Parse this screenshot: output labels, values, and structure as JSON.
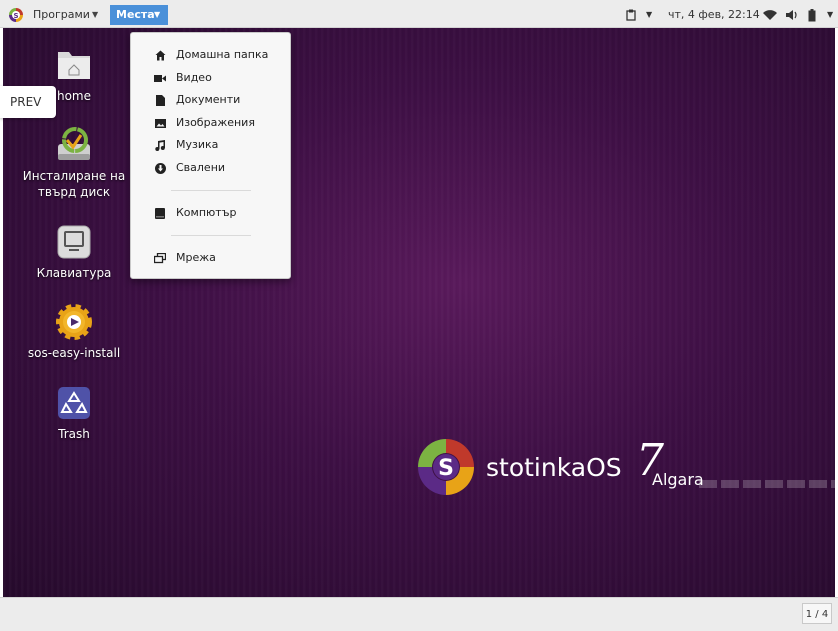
{
  "top_panel": {
    "apps_label": "Програми",
    "places_label": "Места",
    "clock": "чт,  4 фев, 22:14"
  },
  "icons": {
    "apps": "stotinka-logo-icon",
    "clipboard": "clipboard-icon",
    "wifi": "wifi-icon",
    "volume": "volume-icon",
    "battery": "battery-icon"
  },
  "places_menu": {
    "items": [
      {
        "label": "Домашна папка",
        "icon": "home-icon"
      },
      {
        "label": "Видео",
        "icon": "video-camera-icon"
      },
      {
        "label": "Документи",
        "icon": "document-icon"
      },
      {
        "label": "Изображения",
        "icon": "image-icon"
      },
      {
        "label": "Музика",
        "icon": "music-note-icon"
      },
      {
        "label": "Свалени",
        "icon": "download-icon"
      },
      {
        "label": "Компютър",
        "icon": "drive-icon"
      },
      {
        "label": "Мрежа",
        "icon": "network-icon"
      }
    ]
  },
  "desktop": {
    "prev_label": "PREV",
    "icons": [
      {
        "label": "home",
        "icon": "home-folder-icon"
      },
      {
        "label": "Инсталиране на твърд диск",
        "icon": "install-disk-icon"
      },
      {
        "label": "Клавиатура",
        "icon": "keyboard-icon"
      },
      {
        "label": "sos-easy-install",
        "icon": "easy-install-gear-icon"
      },
      {
        "label": "Trash",
        "icon": "trash-icon"
      }
    ]
  },
  "brand": {
    "name": "stotinkaOS",
    "version": "7",
    "codename": "Algara",
    "colors": {
      "red": "#c0392b",
      "green": "#7cb342",
      "purple": "#5b2a86",
      "orange": "#e8a317"
    }
  },
  "bottom_panel": {
    "workspace": "1 / 4"
  }
}
